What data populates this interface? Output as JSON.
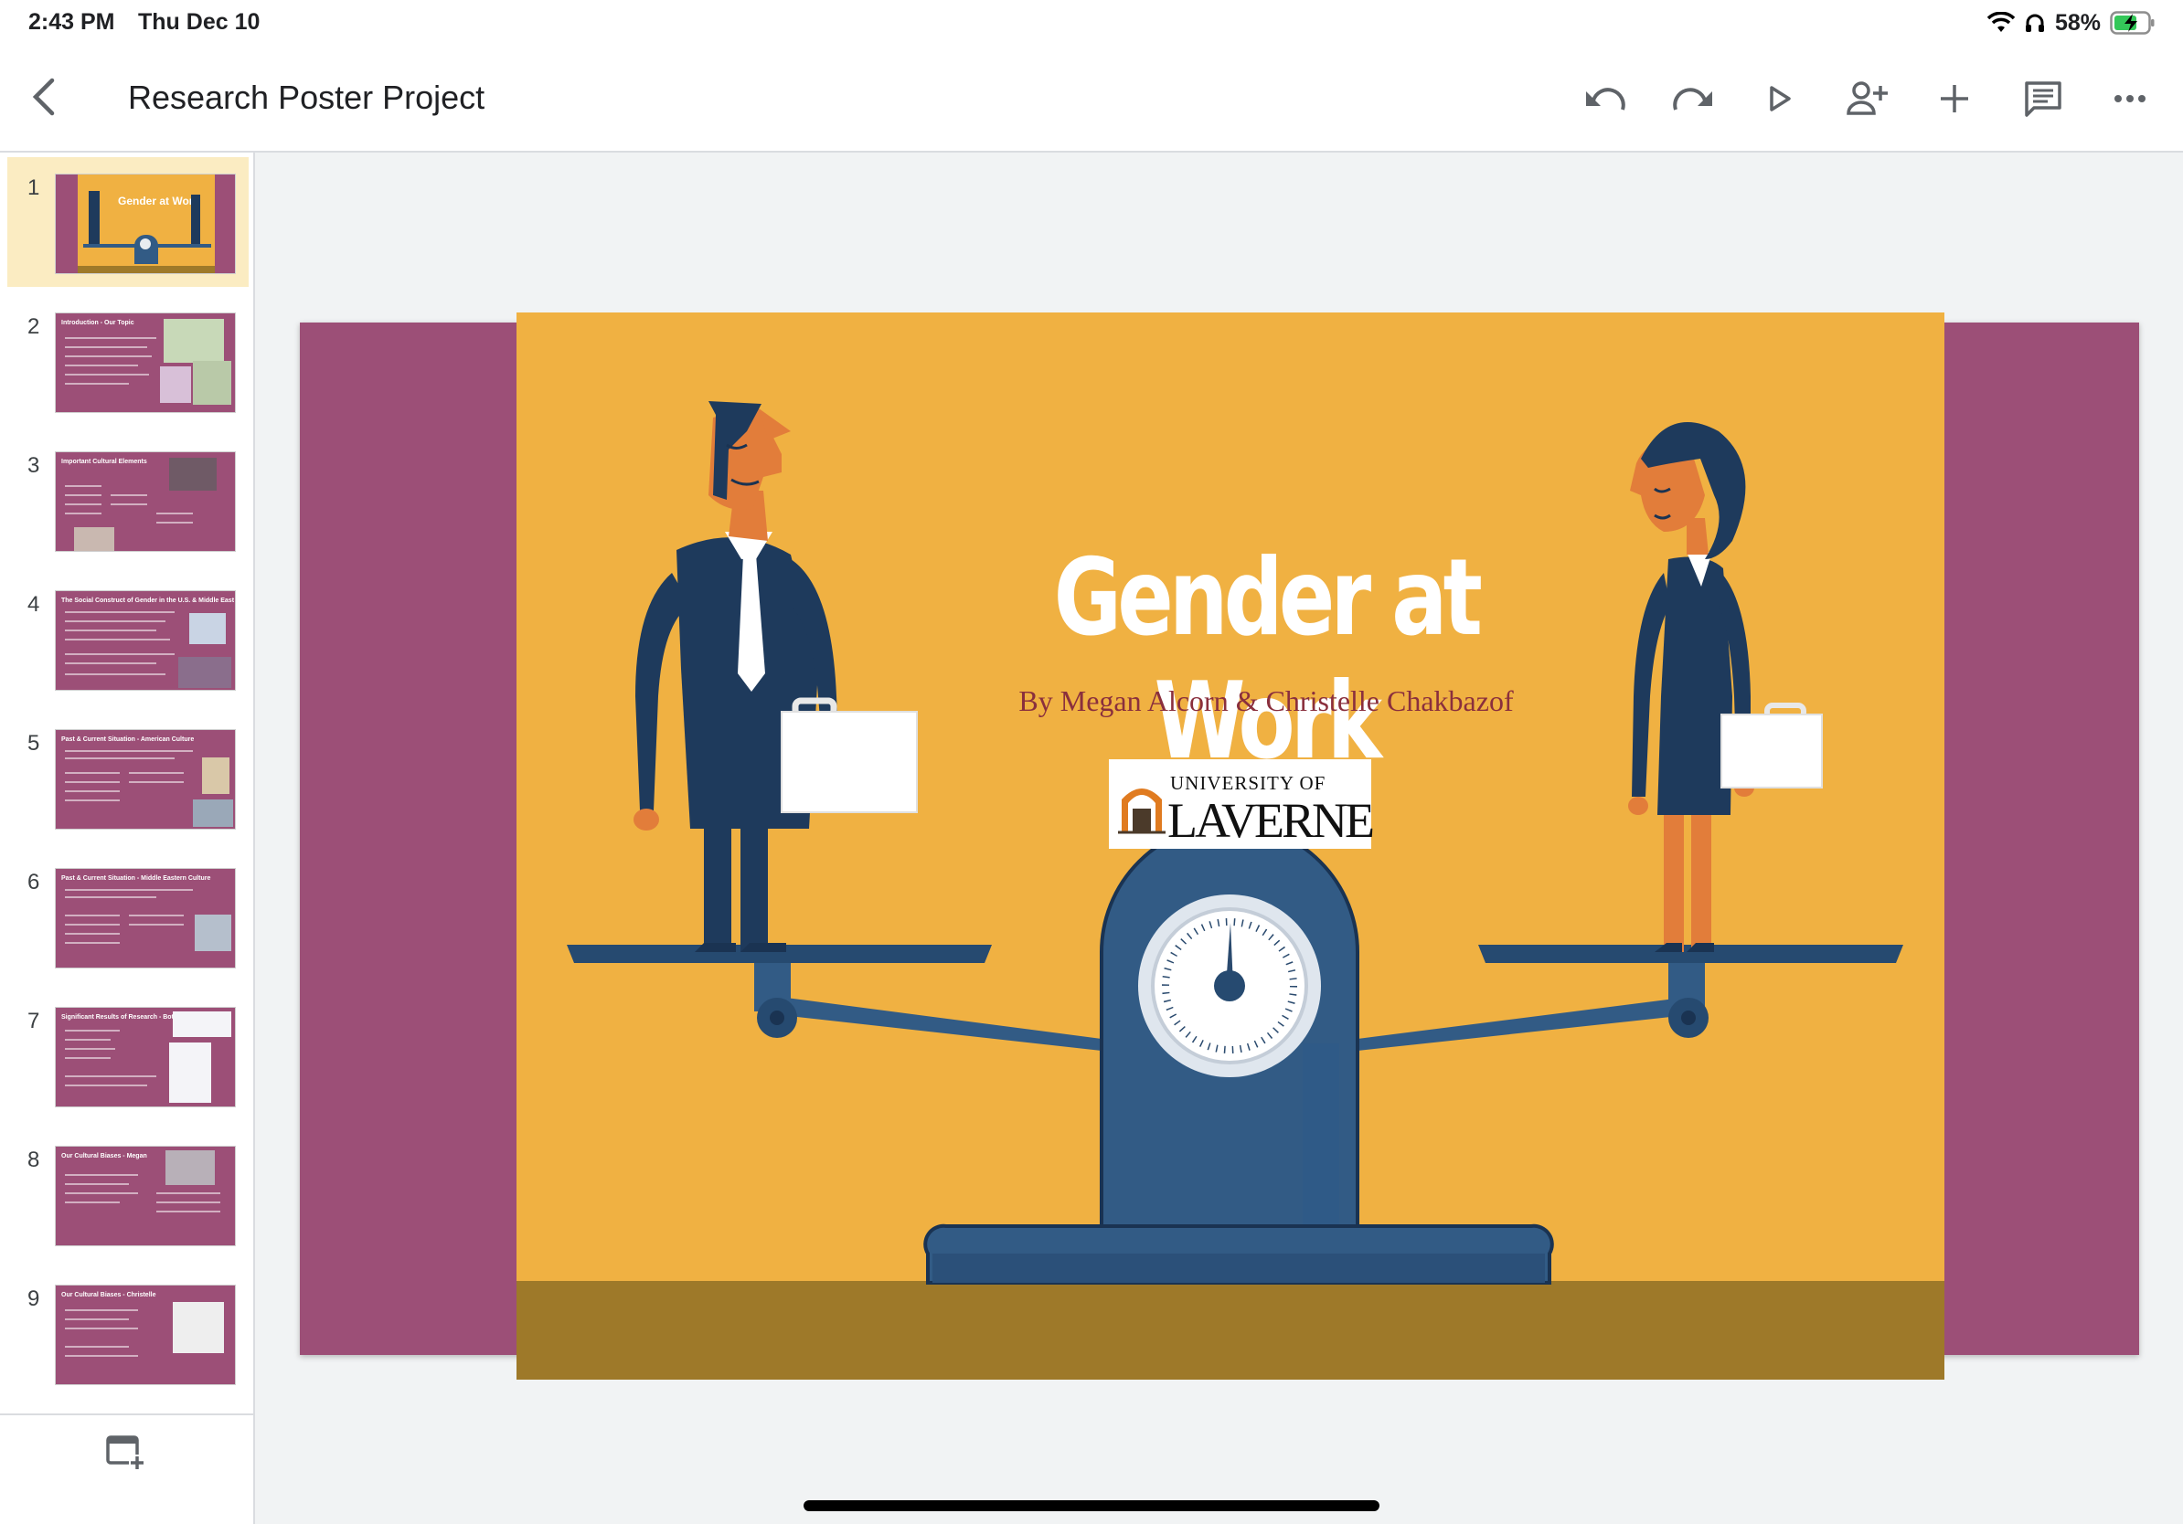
{
  "status": {
    "time": "2:43 PM",
    "date": "Thu Dec 10",
    "battery": "58%"
  },
  "app": {
    "title": "Research Poster Project"
  },
  "toolbar": {
    "icons": [
      "undo-icon",
      "redo-icon",
      "present-icon",
      "share-icon",
      "add-icon",
      "comments-icon",
      "more-icon"
    ]
  },
  "filmstrip": {
    "slides": [
      {
        "number": "1",
        "title": "Gender at Work"
      },
      {
        "number": "2",
        "title": "Introduction - Our Topic"
      },
      {
        "number": "3",
        "title": "Important Cultural Elements"
      },
      {
        "number": "4",
        "title": "The Social Construct of Gender in the U.S. & Middle East"
      },
      {
        "number": "5",
        "title": "Past & Current Situation - American Culture"
      },
      {
        "number": "6",
        "title": "Past & Current Situation - Middle Eastern Culture"
      },
      {
        "number": "7",
        "title": "Significant Results of Research - Both"
      },
      {
        "number": "8",
        "title": "Our Cultural Biases - Megan"
      },
      {
        "number": "9",
        "title": "Our Cultural Biases - Christelle"
      }
    ]
  },
  "slide": {
    "title": "Gender at Work",
    "subtitle": "By Megan Alcorn & Christelle Chakbazof",
    "logo_line1": "UNIVERSITY OF",
    "logo_line2": "LAVERNE"
  },
  "colors": {
    "slide_background": "#f0b142",
    "slide_border": "#9c4f77",
    "floor": "#9e7929",
    "suit": "#1e3a5c",
    "scale": "#325b85",
    "skin": "#e27d3a",
    "selected_thumb": "#fbecc2"
  }
}
